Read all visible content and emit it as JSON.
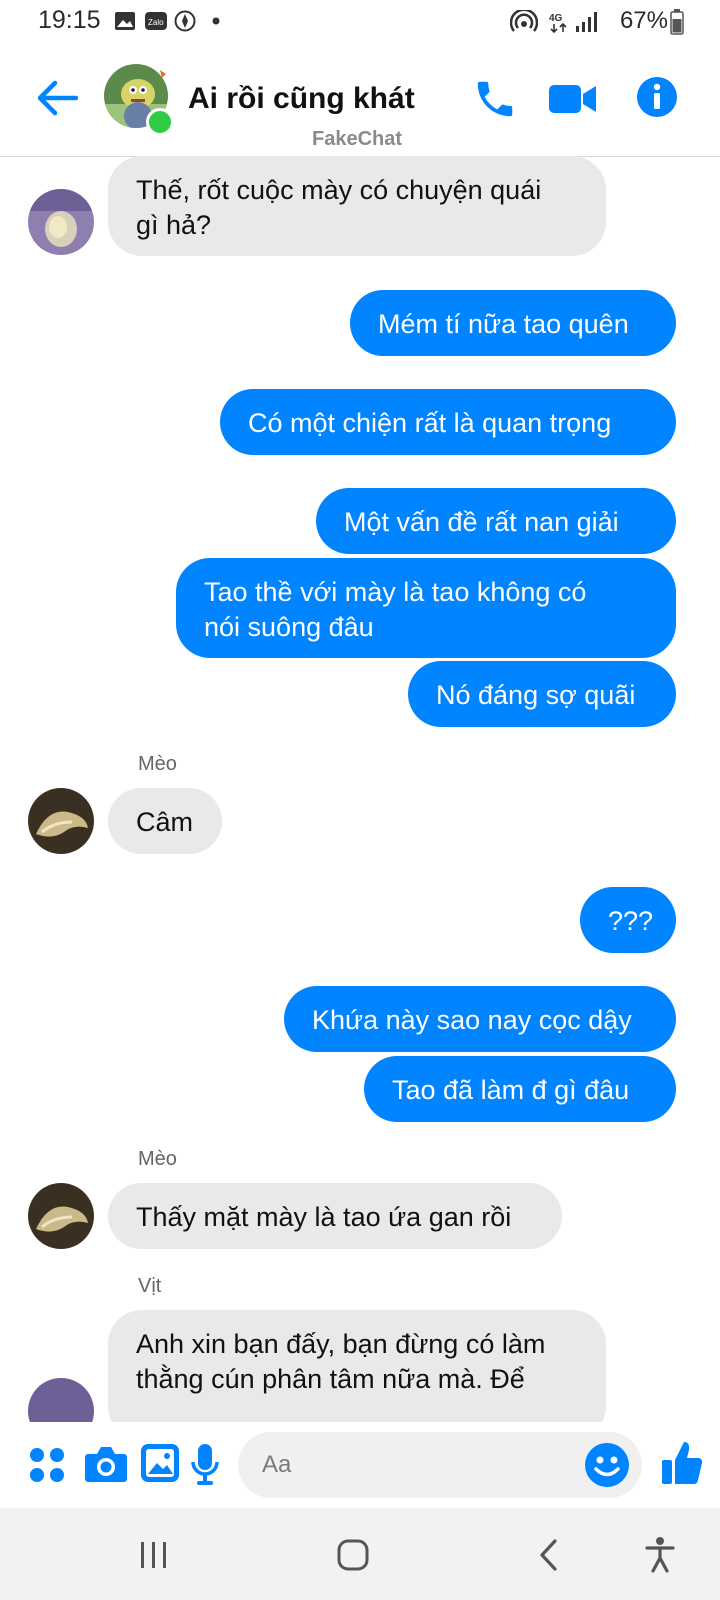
{
  "status_bar": {
    "time": "19:15",
    "battery": "67%",
    "network": "4G"
  },
  "header": {
    "title": "Ai rồi cũng khát",
    "watermark": "FakeChat"
  },
  "messages": [
    {
      "side": "in",
      "text_lines": [
        "Thế, rốt cuộc mày có chuyện quái",
        "gì hả?"
      ]
    },
    {
      "side": "out",
      "text": "Mém tí nữa tao quên"
    },
    {
      "side": "out",
      "text": "Có một chiện rất là quan trọng"
    },
    {
      "side": "out",
      "text": "Một vấn đề rất nan giải"
    },
    {
      "side": "out",
      "text_lines": [
        "Tao thề với mày là tao không có",
        "nói suông đâu"
      ]
    },
    {
      "side": "out",
      "text": "Nó đáng sợ quãi"
    },
    {
      "side": "in",
      "sender": "Mèo",
      "text": "Câm"
    },
    {
      "side": "out",
      "text": "???"
    },
    {
      "side": "out",
      "text": "Khứa này sao nay cọc dậy"
    },
    {
      "side": "out",
      "text": "Tao đã làm đ gì đâu"
    },
    {
      "side": "in",
      "sender": "Mèo",
      "text": "Thấy mặt mày là tao ứa gan rồi"
    },
    {
      "side": "in",
      "sender": "Vịt",
      "text_lines": [
        "Anh xin bạn đấy, bạn đừng có làm",
        "thằng cún phân tâm nữa mà. Để"
      ]
    }
  ],
  "composer": {
    "placeholder": "Aa"
  },
  "colors": {
    "accent": "#0084ff",
    "incoming_bubble": "#e9e9eb",
    "online_dot": "#31cc46"
  },
  "icons": [
    "back-arrow-icon",
    "phone-icon",
    "video-camera-icon",
    "info-icon",
    "apps-icon",
    "camera-icon",
    "gallery-icon",
    "microphone-icon",
    "emoji-icon",
    "thumbs-up-icon",
    "recent-apps-icon",
    "home-icon",
    "back-icon",
    "accessibility-icon"
  ]
}
